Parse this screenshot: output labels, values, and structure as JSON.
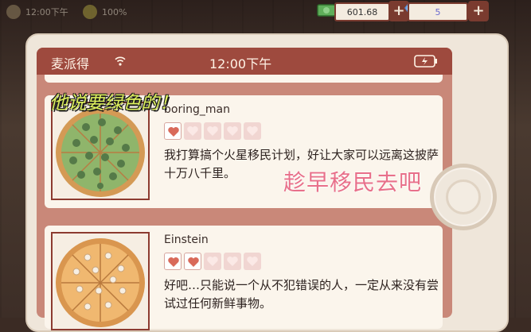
{
  "topbar": {
    "time_faded": "12:00下午",
    "pct_faded": "100%",
    "money": "601.68",
    "gems": "5",
    "plus": "+"
  },
  "phone": {
    "app_name": "麦派得",
    "clock": "12:00下午"
  },
  "posts": [
    {
      "username": "boring_man",
      "rating": 1,
      "rating_max": 5,
      "text": "我打算搞个火星移民计划，好让大家可以远离这披萨十万八千里。",
      "pizza": "green-pizza"
    },
    {
      "username": "Einstein",
      "rating": 2,
      "rating_max": 5,
      "text": "好吧…只能说一个从不犯错误的人，一定从来没有尝试过任何新鲜事物。",
      "pizza": "mushroom-pizza"
    }
  ],
  "overlays": {
    "caption_top": "他说要绿色的！",
    "caption_mid": "趁早移民去吧"
  },
  "colors": {
    "statusbar": "#9e4a3e",
    "caption_top": "#dff25e",
    "caption_mid": "#e8708a",
    "heart_on": "#d96a5a"
  }
}
